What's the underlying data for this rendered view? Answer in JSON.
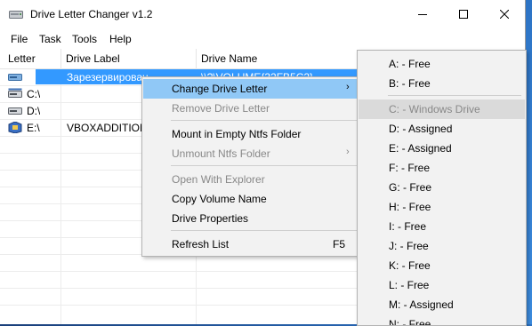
{
  "window": {
    "title": "Drive Letter Changer v1.2"
  },
  "menubar": {
    "items": [
      "File",
      "Task",
      "Tools",
      "Help"
    ]
  },
  "table": {
    "headers": [
      "Letter",
      "Drive Label",
      "Drive Name"
    ],
    "rows": [
      {
        "letter": "",
        "label": "Зарезервирован",
        "name": "\\\\?\\VOLUME{32FB5C2} ..."
      },
      {
        "letter": "C:\\",
        "label": "",
        "name": ""
      },
      {
        "letter": "D:\\",
        "label": "",
        "name": ""
      },
      {
        "letter": "E:\\",
        "label": "VBOXADDITIONS",
        "name": ""
      }
    ]
  },
  "context_menu": {
    "items": [
      {
        "label": "Change Drive Letter",
        "state": "highlighted",
        "submenu": true
      },
      {
        "label": "Remove Drive Letter",
        "state": "disabled"
      },
      {
        "label": "Mount in Empty Ntfs Folder",
        "state": "enabled"
      },
      {
        "label": "Unmount Ntfs Folder",
        "state": "disabled",
        "submenu": true
      },
      {
        "label": "Open With Explorer",
        "state": "disabled"
      },
      {
        "label": "Copy Volume Name",
        "state": "enabled"
      },
      {
        "label": "Drive Properties",
        "state": "enabled"
      },
      {
        "label": "Refresh List",
        "state": "enabled",
        "shortcut": "F5"
      }
    ]
  },
  "submenu": {
    "items": [
      "A: - Free",
      "B: - Free",
      "C: - Windows Drive",
      "D: - Assigned",
      "E: - Assigned",
      "F: - Free",
      "G: - Free",
      "H: - Free",
      "I: - Free",
      "J: - Free",
      "K: - Free",
      "L: - Free",
      "M: - Assigned",
      "N: - Free"
    ]
  },
  "icons": {
    "app": "drive-icon",
    "minimize": "minimize-icon",
    "maximize": "maximize-icon",
    "close": "close-icon",
    "submenu_arrow": "chevron-right-icon"
  }
}
